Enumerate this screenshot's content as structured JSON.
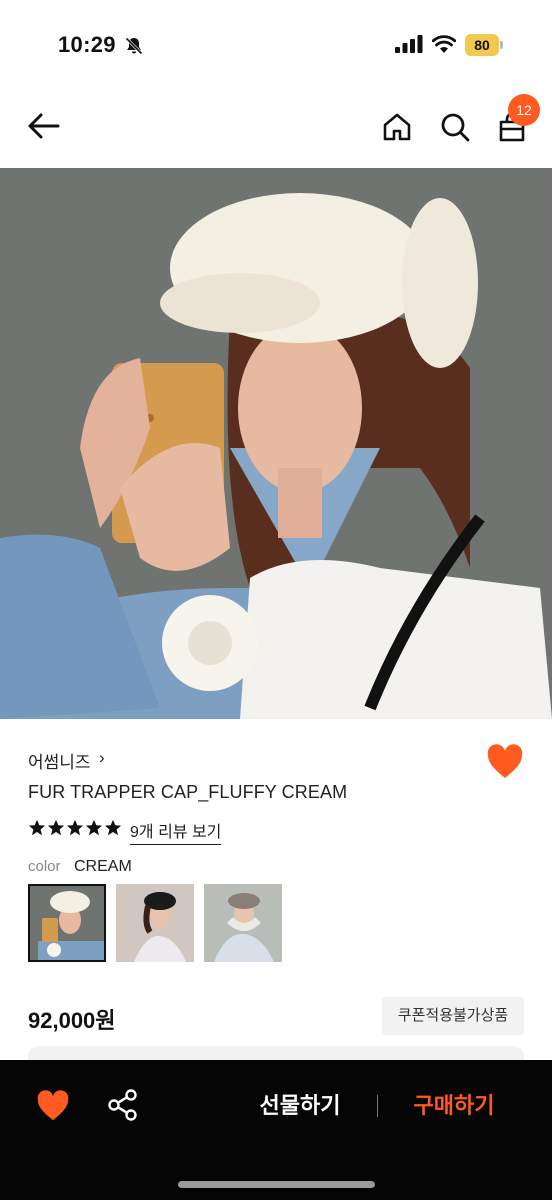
{
  "status_bar": {
    "time": "10:29",
    "battery": "80"
  },
  "nav": {
    "back_icon": "arrow-left-icon",
    "home_icon": "home-icon",
    "search_icon": "search-icon",
    "bag_icon": "shopping-bag-icon",
    "cart_count": "12"
  },
  "product": {
    "brand": "어썸니즈",
    "brand_chevron": "›",
    "name": "FUR TRAPPER CAP_FLUFFY CREAM",
    "rating_stars": 5,
    "review_link": "9개 리뷰 보기",
    "color_label": "color",
    "color_value": "CREAM",
    "price": "92,000원",
    "coupon_notice": "쿠폰적용불가상품",
    "liked": true
  },
  "bottom_bar": {
    "gift_label": "선물하기",
    "buy_label": "구매하기",
    "like_icon": "heart-icon",
    "share_icon": "share-icon"
  },
  "colors": {
    "accent": "#ff5a1f",
    "bottom_bar_bg": "#050505",
    "battery": "#f2c94c"
  }
}
